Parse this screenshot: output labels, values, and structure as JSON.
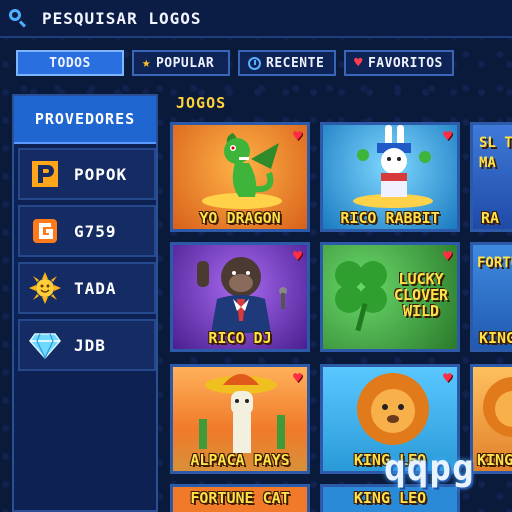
{
  "search": {
    "placeholder": "PESQUISAR LOGOS"
  },
  "tabs": [
    {
      "label": "TODOS",
      "active": true
    },
    {
      "label": "POPULAR",
      "icon": "star-icon"
    },
    {
      "label": "RECENTE",
      "icon": "clock-icon"
    },
    {
      "label": "FAVORITOS",
      "icon": "heart-icon"
    }
  ],
  "sidebar": {
    "header": "PROVEDORES",
    "items": [
      {
        "label": "POPOK",
        "icon": "popok-logo-icon"
      },
      {
        "label": "G759",
        "icon": "g759-logo-icon"
      },
      {
        "label": "TADA",
        "icon": "sun-icon"
      },
      {
        "label": "JDB",
        "icon": "diamond-icon"
      }
    ]
  },
  "games": {
    "title": "JOGOS",
    "cards": [
      {
        "label": "YO DRAGON",
        "bg": "#e07a2a"
      },
      {
        "label": "RICO RABBIT",
        "bg": "#2aa0d6"
      },
      {
        "label": "RA",
        "bg": "#2f6fcf"
      },
      {
        "label": "RICO DJ",
        "bg": "#6a2fb0"
      },
      {
        "label": "LUCKY CLOVER WILD",
        "bg": "#3f9a3a"
      },
      {
        "label": "KING",
        "bg": "#2a7ad0"
      },
      {
        "label": "ALPACA PAYS",
        "bg": "#f08a3a"
      },
      {
        "label": "KING LEO",
        "bg": "#2fa0e0"
      },
      {
        "label": "KING",
        "bg": "#f0a040"
      },
      {
        "label": "FORTUNE CAT",
        "bg": "#f07a2a"
      },
      {
        "label": "KING LEO",
        "bg": "#2a8ad8"
      }
    ],
    "partial_labels": {
      "slot_top": "SL TO MA",
      "fortune": "FORTU"
    }
  },
  "watermark": "qqpg"
}
